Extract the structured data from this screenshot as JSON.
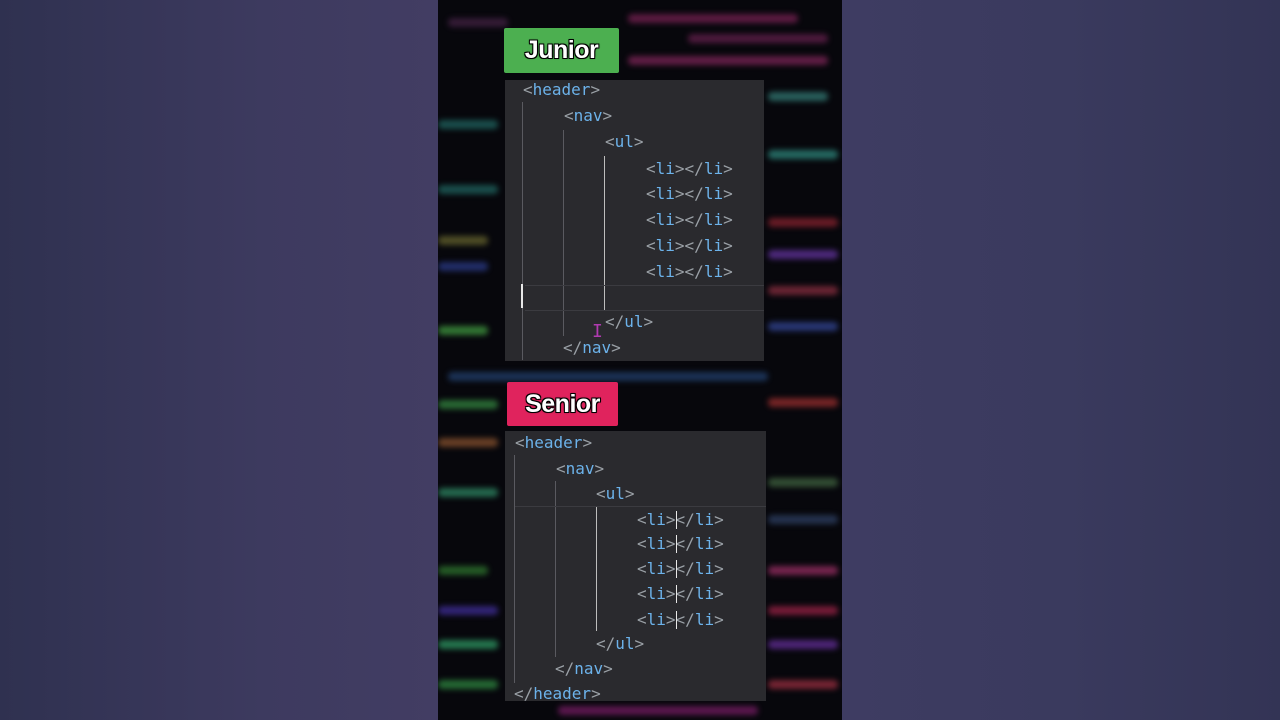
{
  "badges": {
    "junior": "Junior",
    "senior": "Senior"
  },
  "colors": {
    "junior_badge": "#4caf50",
    "senior_badge": "#e0235d",
    "editor_bg": "#2a2a2e",
    "tag_color": "#6cb2ea"
  },
  "junior_code": {
    "header_open": "header",
    "nav_open": "nav",
    "ul_open": "ul",
    "li_items": [
      "li",
      "li",
      "li",
      "li",
      "li"
    ],
    "ul_close": "ul",
    "nav_close": "nav"
  },
  "senior_code": {
    "header_open": "header",
    "nav_open": "nav",
    "ul_open": "ul",
    "li_items": [
      "li",
      "li",
      "li",
      "li",
      "li"
    ],
    "ul_close": "ul",
    "nav_close": "nav",
    "header_close": "header"
  },
  "icons": {
    "text_cursor": "i-beam-cursor-icon"
  }
}
